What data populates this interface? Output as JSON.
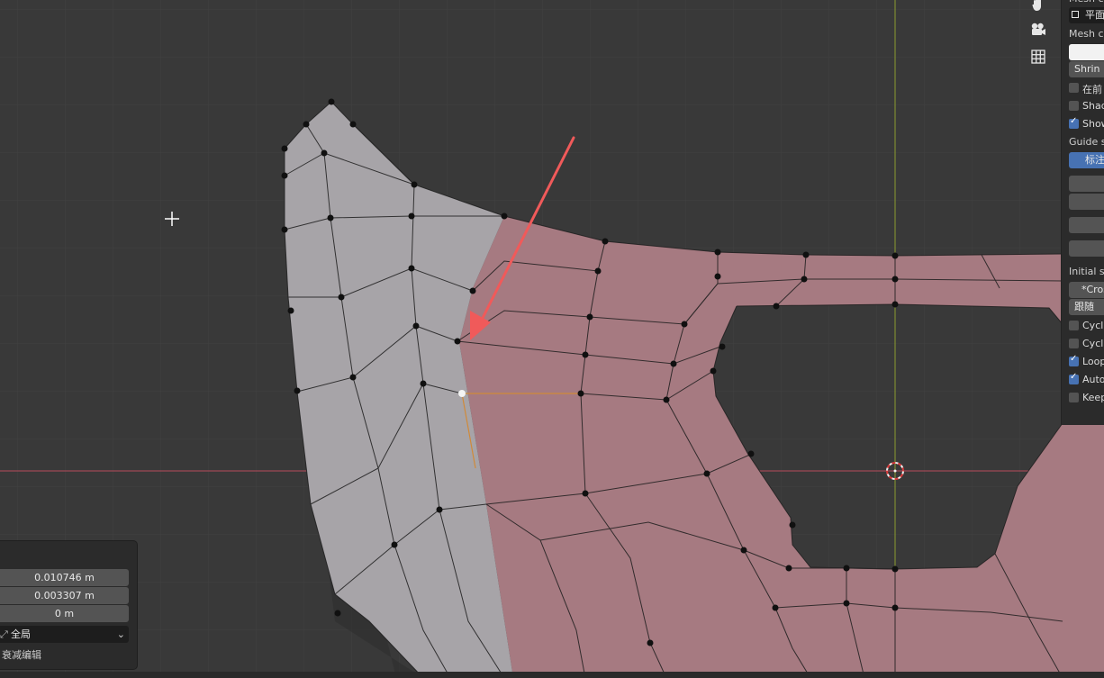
{
  "npanel": {
    "header_cut": "Mesh c",
    "mesh_source_value": "平面",
    "mesh_collection_label": "Mesh co",
    "shrink_button": "Shrin",
    "checkbox_front": "在前",
    "checkbox_shade": "Shad",
    "checkbox_show": "Show",
    "guide_label": "Guide s",
    "guide_tab_active": "标注",
    "initial_label": "Initial s",
    "cross_button": "*Cros",
    "follow_button": "跟随",
    "checkbox_cyclic1": "Cycli",
    "checkbox_cyclic2": "Cycli",
    "checkbox_loop": "Loop",
    "checkbox_auto": "Autor",
    "checkbox_keep": "Keep"
  },
  "operator_panel": {
    "field_x": "0.010746 m",
    "field_y": "0.003307 m",
    "field_z": "0 m",
    "orientation_value": "全局",
    "proportional_label": "衰减编辑"
  },
  "colors": {
    "background": "#393939",
    "grid": "#414141",
    "axis_x": "#b84a5c",
    "axis_y": "#8c9a2e",
    "mesh_grey": "#a7a4a8",
    "mesh_pink": "#a67a81",
    "annotation_arrow": "#f05a5a",
    "panel_bg": "#2b2b2b",
    "accent_blue": "#4772b3"
  },
  "icons": [
    "hand-pan-icon",
    "camera-icon",
    "grid-icon",
    "3d-cursor-icon",
    "crosshair-cursor-icon"
  ]
}
